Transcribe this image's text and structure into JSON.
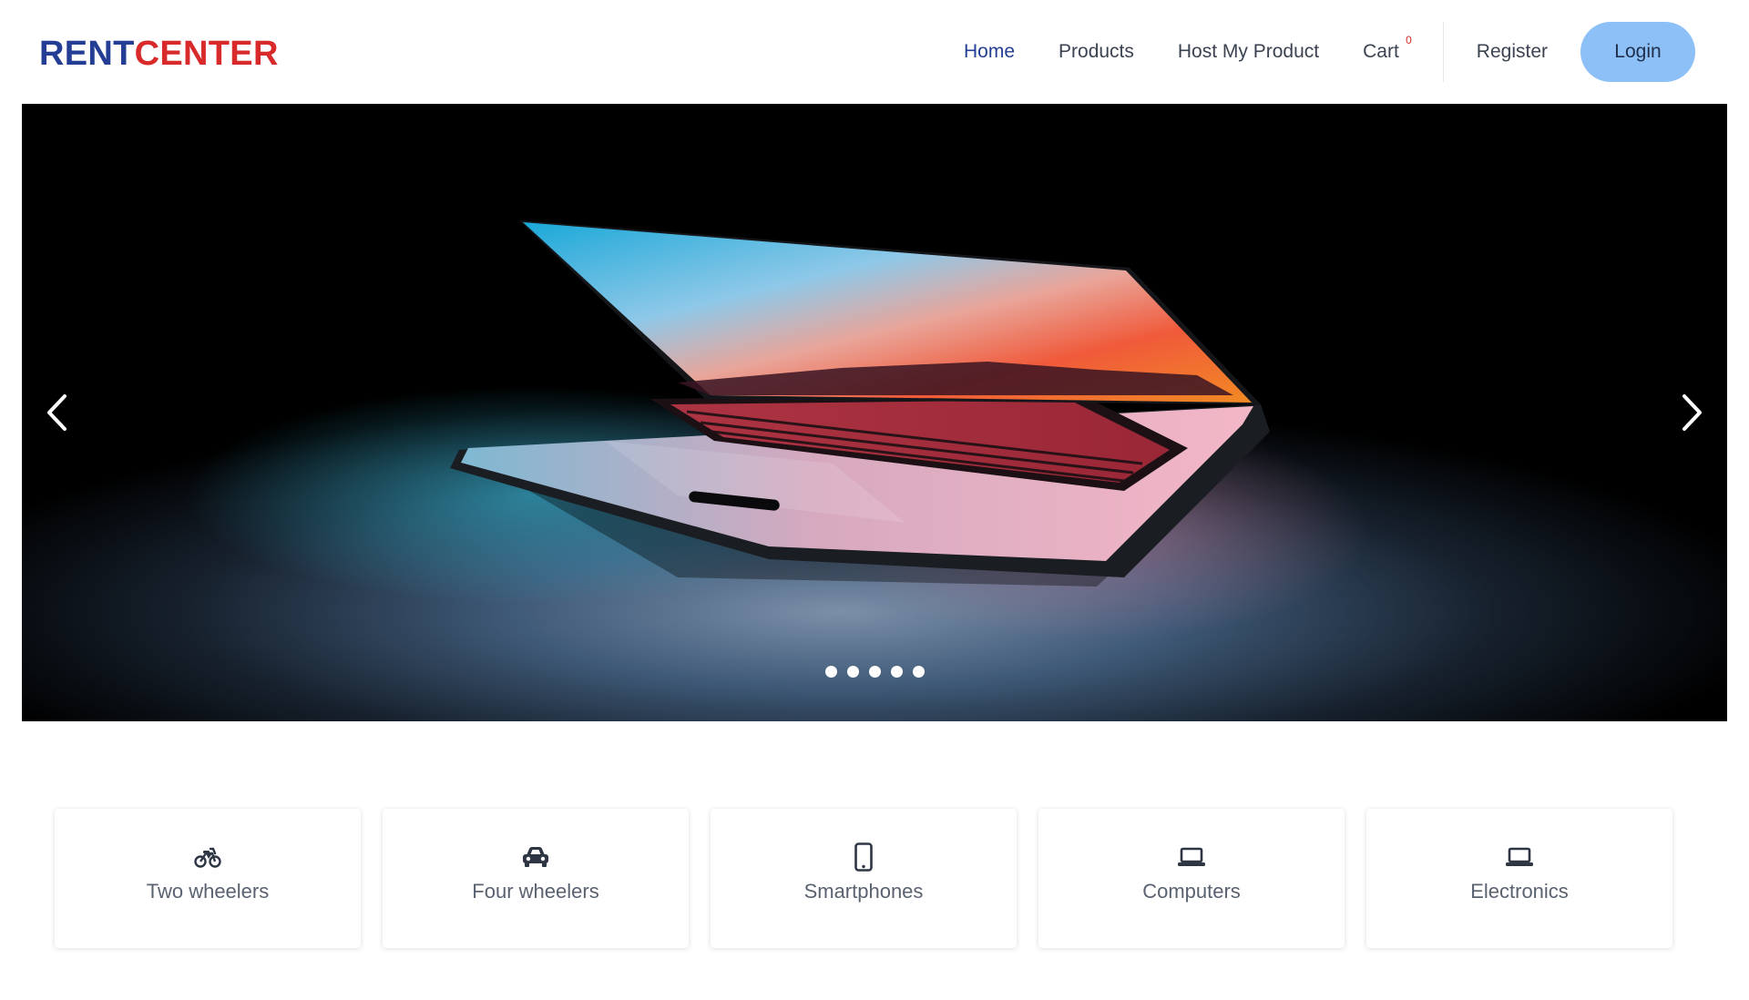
{
  "brand": {
    "part1": "RENT",
    "part2": "CENTER"
  },
  "nav": {
    "home": "Home",
    "products": "Products",
    "host": "Host My Product",
    "cart": "Cart",
    "cart_count": "0",
    "register": "Register",
    "login": "Login"
  },
  "carousel": {
    "slide_count": 5,
    "active_index": 0
  },
  "categories": [
    {
      "label": "Two wheelers",
      "icon": "motorcycle-icon"
    },
    {
      "label": "Four wheelers",
      "icon": "car-icon"
    },
    {
      "label": "Smartphones",
      "icon": "smartphone-icon"
    },
    {
      "label": "Computers",
      "icon": "laptop-icon"
    },
    {
      "label": "Electronics",
      "icon": "laptop-icon"
    }
  ],
  "colors": {
    "brand_blue": "#233e94",
    "brand_red": "#d82a2a",
    "login_bg": "#8ec0f8",
    "icon_color": "#2e3644"
  }
}
